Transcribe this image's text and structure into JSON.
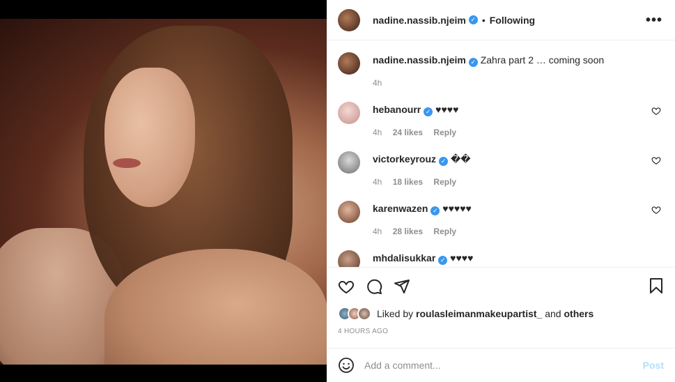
{
  "post": {
    "username": "nadine.nassib.njeim",
    "follow_status": "Following",
    "more_label": "•••",
    "caption": "Zahra part 2 … coming soon",
    "caption_time": "4h"
  },
  "comments": [
    {
      "username": "hebanourr",
      "text": "♥♥♥♥",
      "time": "4h",
      "likes": "24 likes",
      "reply": "Reply"
    },
    {
      "username": "victorkeyrouz",
      "text": "��",
      "time": "4h",
      "likes": "18 likes",
      "reply": "Reply"
    },
    {
      "username": "karenwazen",
      "text": "♥♥♥♥♥",
      "time": "4h",
      "likes": "28 likes",
      "reply": "Reply"
    },
    {
      "username": "mhdalisukkar",
      "text": "♥♥♥♥"
    }
  ],
  "actions": {
    "liked_prefix": "Liked by",
    "liked_user": "roulasleimanmakeupartist_",
    "liked_and": "and",
    "liked_others": "others",
    "timestamp": "4 HOURS AGO"
  },
  "add_comment": {
    "placeholder": "Add a comment...",
    "post_label": "Post"
  },
  "colors": {
    "verified": "#3897f0",
    "post_disabled": "#b2dffc",
    "muted": "#8e8e8e"
  }
}
